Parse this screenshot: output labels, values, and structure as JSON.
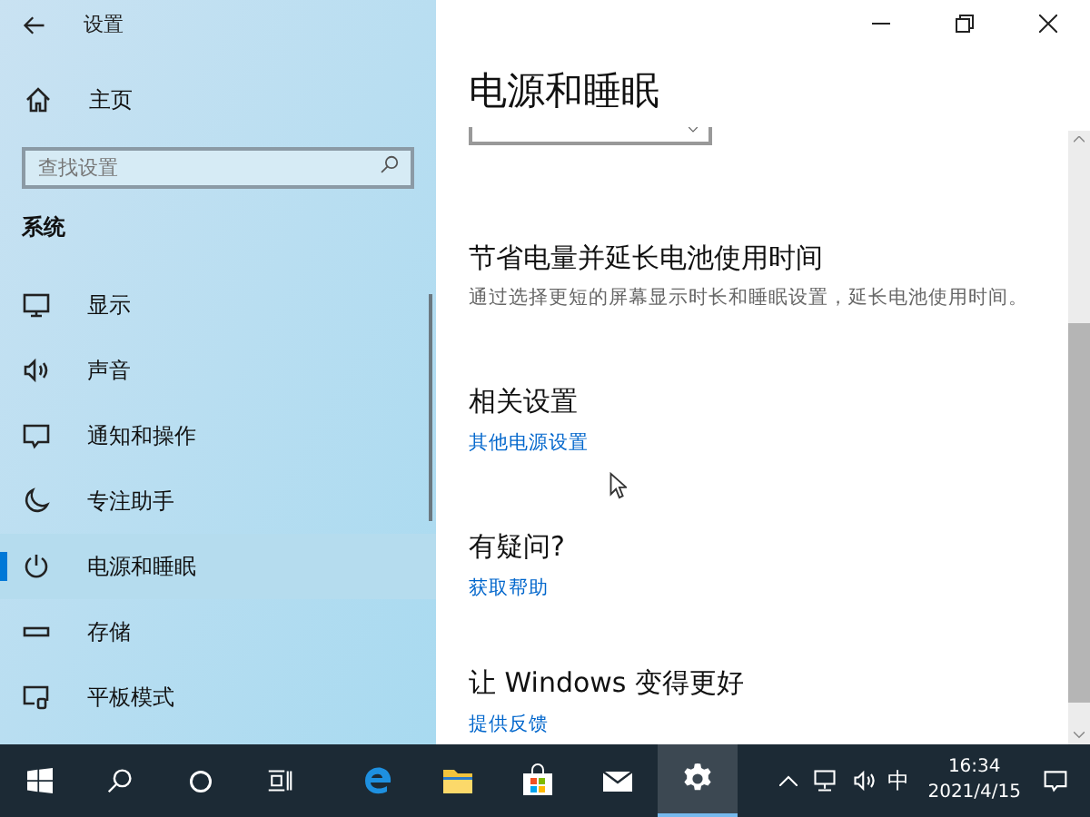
{
  "window": {
    "title": "设置"
  },
  "sidebar": {
    "home": "主页",
    "search": {
      "placeholder": "查找设置"
    },
    "section": "系统",
    "items": [
      {
        "label": "显示",
        "selected": false
      },
      {
        "label": "声音",
        "selected": false
      },
      {
        "label": "通知和操作",
        "selected": false
      },
      {
        "label": "专注助手",
        "selected": false
      },
      {
        "label": "电源和睡眠",
        "selected": true
      },
      {
        "label": "存储",
        "selected": false
      },
      {
        "label": "平板模式",
        "selected": false
      }
    ]
  },
  "page": {
    "title": "电源和睡眠",
    "sections": [
      {
        "heading": "节省电量并延长电池使用时间",
        "description": "通过选择更短的屏幕显示时长和睡眠设置，延长电池使用时间。"
      },
      {
        "heading": "相关设置",
        "link": "其他电源设置"
      },
      {
        "heading": "有疑问?",
        "link": "获取帮助"
      },
      {
        "heading": "让 Windows 变得更好",
        "link": "提供反馈"
      }
    ]
  },
  "taskbar": {
    "apps": [
      {
        "selected": false
      },
      {
        "selected": false
      },
      {
        "selected": false
      },
      {
        "selected": false
      },
      {
        "selected": true
      }
    ],
    "ime": "中",
    "time": "16:34",
    "date": "2021/4/15"
  }
}
